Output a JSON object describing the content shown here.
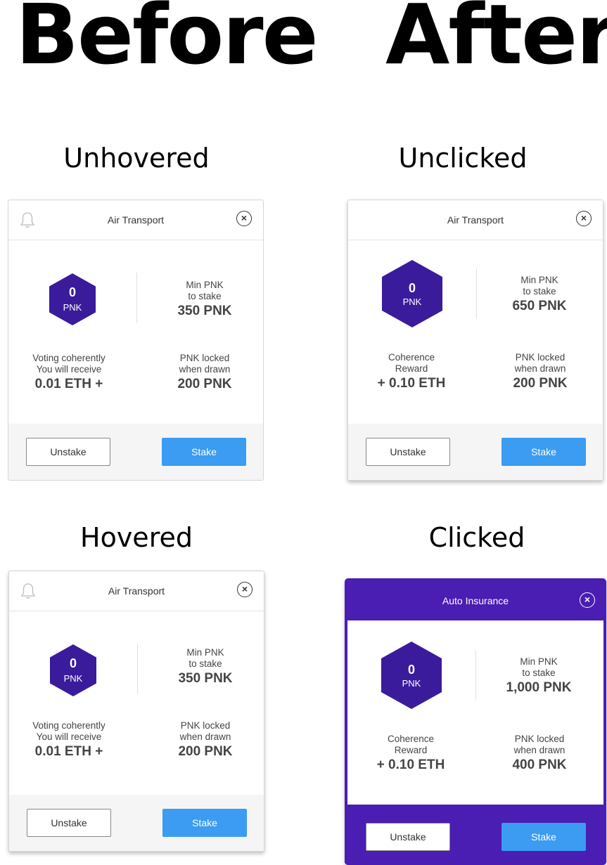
{
  "headings": {
    "before": "Before",
    "after": "After"
  },
  "cards": {
    "unhovered": {
      "state_label": "Unhovered",
      "title": "Air Transport",
      "close_glyph": "×",
      "hex_value": "0",
      "hex_unit": "PNK",
      "min_label_1": "Min PNK",
      "min_label_2": "to stake",
      "min_value": "350 PNK",
      "reward_label_1": "Voting coherently",
      "reward_label_2": "You will receive",
      "reward_value": "0.01 ETH +",
      "locked_label_1": "PNK locked",
      "locked_label_2": "when drawn",
      "locked_value": "200 PNK",
      "unstake_label": "Unstake",
      "stake_label": "Stake"
    },
    "hovered": {
      "state_label": "Hovered",
      "title": "Air Transport",
      "close_glyph": "×",
      "hex_value": "0",
      "hex_unit": "PNK",
      "min_label_1": "Min PNK",
      "min_label_2": "to stake",
      "min_value": "350 PNK",
      "reward_label_1": "Voting coherently",
      "reward_label_2": "You will receive",
      "reward_value": "0.01 ETH +",
      "locked_label_1": "PNK locked",
      "locked_label_2": "when drawn",
      "locked_value": "200 PNK",
      "unstake_label": "Unstake",
      "stake_label": "Stake"
    },
    "unclicked": {
      "state_label": "Unclicked",
      "title": "Air Transport",
      "close_glyph": "×",
      "hex_value": "0",
      "hex_unit": "PNK",
      "min_label_1": "Min PNK",
      "min_label_2": "to stake",
      "min_value": "650 PNK",
      "reward_label_1": "Coherence",
      "reward_label_2": "Reward",
      "reward_value": "+ 0.10 ETH",
      "locked_label_1": "PNK locked",
      "locked_label_2": "when drawn",
      "locked_value": "200 PNK",
      "unstake_label": "Unstake",
      "stake_label": "Stake"
    },
    "clicked": {
      "state_label": "Clicked",
      "title": "Auto Insurance",
      "close_glyph": "×",
      "hex_value": "0",
      "hex_unit": "PNK",
      "min_label_1": "Min PNK",
      "min_label_2": "to stake",
      "min_value": "1,000 PNK",
      "reward_label_1": "Coherence",
      "reward_label_2": "Reward",
      "reward_value": "+ 0.10 ETH",
      "locked_label_1": "PNK locked",
      "locked_label_2": "when drawn",
      "locked_value": "400 PNK",
      "unstake_label": "Unstake",
      "stake_label": "Stake"
    }
  },
  "colors": {
    "brand_purple": "#4a1db3",
    "hex_purple": "#3a1b9c",
    "stake_blue": "#3b9cf2",
    "footer_grey": "#f5f5f5"
  },
  "icons": {
    "bell": "bell-icon",
    "close": "close-icon",
    "hexagon": "hexagon-badge"
  }
}
